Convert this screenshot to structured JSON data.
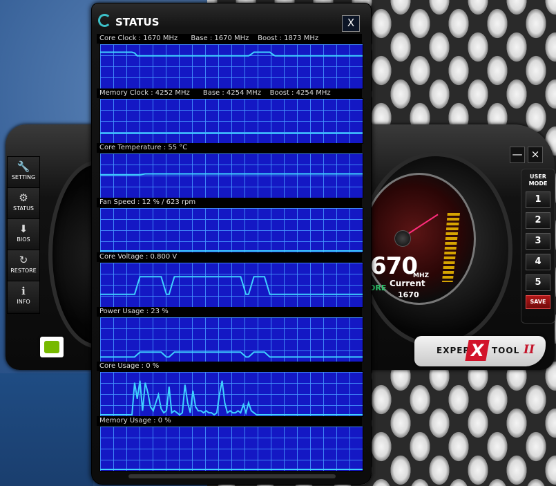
{
  "status_window": {
    "title": "STATUS",
    "close_label": "X",
    "panels": [
      {
        "label": "Core Clock : 1670 MHz      Base : 1670 MHz    Boost : 1873 MHz",
        "series": [
          0.87,
          0.87,
          0.87,
          0.87,
          0.87,
          0.87,
          0.87,
          0.87,
          0.87,
          0.87,
          0.87,
          0.87,
          0.87,
          0.85,
          0.78,
          0.78,
          0.78,
          0.78,
          0.78,
          0.78,
          0.78,
          0.78,
          0.78,
          0.78,
          0.78,
          0.78,
          0.78,
          0.78,
          0.78,
          0.78,
          0.78,
          0.78,
          0.78,
          0.78,
          0.78,
          0.78,
          0.78,
          0.78,
          0.78,
          0.78,
          0.78,
          0.78,
          0.78,
          0.78,
          0.78,
          0.78,
          0.78,
          0.78,
          0.78,
          0.78,
          0.78,
          0.78,
          0.78,
          0.78,
          0.78,
          0.78,
          0.78,
          0.82,
          0.87,
          0.87,
          0.87,
          0.87,
          0.87,
          0.87,
          0.87,
          0.82,
          0.78,
          0.78,
          0.78,
          0.78,
          0.78,
          0.78,
          0.78,
          0.78,
          0.78,
          0.78,
          0.78,
          0.78,
          0.78,
          0.78,
          0.78,
          0.78,
          0.78,
          0.78,
          0.78,
          0.78,
          0.78,
          0.78,
          0.78,
          0.78,
          0.78,
          0.78,
          0.78,
          0.78,
          0.78,
          0.78,
          0.78,
          0.78,
          0.78,
          0.78
        ]
      },
      {
        "label": "Memory Clock : 4252 MHz      Base : 4254 MHz    Boost : 4254 MHz",
        "series": [
          0.21,
          0.21,
          0.21,
          0.21,
          0.21,
          0.21,
          0.21,
          0.21,
          0.21,
          0.21,
          0.21,
          0.21,
          0.21,
          0.21,
          0.21,
          0.21,
          0.21,
          0.21,
          0.21,
          0.21,
          0.21,
          0.21,
          0.21,
          0.21,
          0.21,
          0.21,
          0.21,
          0.21,
          0.21,
          0.21,
          0.21,
          0.21,
          0.21,
          0.21,
          0.21,
          0.21,
          0.21,
          0.21,
          0.21,
          0.21,
          0.21,
          0.21,
          0.21,
          0.21,
          0.21,
          0.21,
          0.21,
          0.21,
          0.21,
          0.21,
          0.21,
          0.21,
          0.21,
          0.21,
          0.21,
          0.21,
          0.21,
          0.21,
          0.21,
          0.21,
          0.21,
          0.21,
          0.21,
          0.21,
          0.21,
          0.21,
          0.21,
          0.21,
          0.21,
          0.21,
          0.21,
          0.21,
          0.21,
          0.21,
          0.21,
          0.21,
          0.21,
          0.21,
          0.21,
          0.21,
          0.21,
          0.21,
          0.21,
          0.21,
          0.21,
          0.21,
          0.21,
          0.21,
          0.21,
          0.21,
          0.21,
          0.21,
          0.21,
          0.21,
          0.21,
          0.21,
          0.21,
          0.21,
          0.21,
          0.21
        ]
      },
      {
        "label": "Core Temperature : 55 °C",
        "series": [
          0.54,
          0.54,
          0.54,
          0.54,
          0.54,
          0.54,
          0.54,
          0.54,
          0.54,
          0.54,
          0.54,
          0.54,
          0.54,
          0.54,
          0.54,
          0.54,
          0.55,
          0.56,
          0.56,
          0.56,
          0.56,
          0.56,
          0.56,
          0.56,
          0.56,
          0.56,
          0.56,
          0.56,
          0.56,
          0.56,
          0.56,
          0.56,
          0.56,
          0.56,
          0.56,
          0.56,
          0.56,
          0.56,
          0.56,
          0.56,
          0.56,
          0.56,
          0.56,
          0.56,
          0.56,
          0.56,
          0.56,
          0.56,
          0.56,
          0.56,
          0.56,
          0.56,
          0.56,
          0.56,
          0.56,
          0.56,
          0.56,
          0.56,
          0.56,
          0.56,
          0.56,
          0.56,
          0.56,
          0.56,
          0.56,
          0.56,
          0.56,
          0.56,
          0.56,
          0.56,
          0.56,
          0.56,
          0.56,
          0.56,
          0.56,
          0.56,
          0.56,
          0.56,
          0.56,
          0.56,
          0.56,
          0.56,
          0.56,
          0.56,
          0.56,
          0.56,
          0.56,
          0.56,
          0.56,
          0.56,
          0.56,
          0.56,
          0.56,
          0.56,
          0.56,
          0.56,
          0.56,
          0.56,
          0.56,
          0.56
        ]
      },
      {
        "label": "Fan Speed : 12 % / 623 rpm",
        "series": [
          0.0,
          0.0,
          0.0,
          0.0,
          0.0,
          0.0,
          0.0,
          0.0,
          0.0,
          0.0,
          0.0,
          0.0,
          0.0,
          0.0,
          0.0,
          0.0,
          0.0,
          0.0,
          0.0,
          0.0,
          0.0,
          0.0,
          0.0,
          0.0,
          0.0,
          0.0,
          0.0,
          0.0,
          0.0,
          0.0,
          0.0,
          0.0,
          0.0,
          0.0,
          0.0,
          0.0,
          0.0,
          0.0,
          0.0,
          0.0,
          0.0,
          0.0,
          0.0,
          0.0,
          0.0,
          0.0,
          0.0,
          0.0,
          0.0,
          0.0,
          0.0,
          0.0,
          0.0,
          0.0,
          0.0,
          0.0,
          0.0,
          0.0,
          0.0,
          0.0,
          0.0,
          0.0,
          0.0,
          0.0,
          0.0,
          0.0,
          0.0,
          0.0,
          0.0,
          0.0,
          0.0,
          0.0,
          0.0,
          0.0,
          0.0,
          0.0,
          0.0,
          0.0,
          0.0,
          0.0,
          0.0,
          0.0,
          0.0,
          0.0,
          0.0,
          0.0,
          0.0,
          0.0,
          0.0,
          0.0,
          0.0,
          0.0,
          0.0,
          0.0,
          0.0,
          0.0,
          0.0,
          0.0,
          0.0,
          0.0
        ]
      },
      {
        "label": "Core Voltage : 0.800 V",
        "series": [
          0.28,
          0.28,
          0.28,
          0.28,
          0.28,
          0.28,
          0.28,
          0.28,
          0.28,
          0.28,
          0.28,
          0.28,
          0.28,
          0.28,
          0.5,
          0.72,
          0.72,
          0.72,
          0.72,
          0.72,
          0.72,
          0.72,
          0.72,
          0.72,
          0.5,
          0.28,
          0.28,
          0.5,
          0.72,
          0.72,
          0.72,
          0.72,
          0.72,
          0.72,
          0.72,
          0.72,
          0.72,
          0.72,
          0.72,
          0.72,
          0.72,
          0.72,
          0.72,
          0.72,
          0.72,
          0.72,
          0.72,
          0.72,
          0.72,
          0.72,
          0.72,
          0.72,
          0.72,
          0.72,
          0.5,
          0.28,
          0.28,
          0.5,
          0.72,
          0.72,
          0.72,
          0.72,
          0.72,
          0.5,
          0.28,
          0.28,
          0.28,
          0.28,
          0.28,
          0.28,
          0.28,
          0.28,
          0.28,
          0.28,
          0.28,
          0.28,
          0.28,
          0.28,
          0.28,
          0.28,
          0.28,
          0.28,
          0.28,
          0.28,
          0.28,
          0.28,
          0.28,
          0.28,
          0.28,
          0.28,
          0.28,
          0.28,
          0.28,
          0.28,
          0.28,
          0.28,
          0.28,
          0.28,
          0.28,
          0.28
        ]
      },
      {
        "label": "Power Usage : 23 %",
        "series": [
          0.08,
          0.08,
          0.08,
          0.08,
          0.08,
          0.08,
          0.08,
          0.08,
          0.08,
          0.08,
          0.08,
          0.08,
          0.08,
          0.08,
          0.14,
          0.2,
          0.2,
          0.2,
          0.2,
          0.2,
          0.2,
          0.2,
          0.2,
          0.2,
          0.14,
          0.08,
          0.08,
          0.14,
          0.2,
          0.2,
          0.2,
          0.2,
          0.2,
          0.2,
          0.2,
          0.2,
          0.2,
          0.2,
          0.2,
          0.2,
          0.2,
          0.2,
          0.2,
          0.2,
          0.2,
          0.2,
          0.2,
          0.2,
          0.2,
          0.2,
          0.2,
          0.2,
          0.2,
          0.2,
          0.14,
          0.08,
          0.08,
          0.14,
          0.2,
          0.2,
          0.2,
          0.2,
          0.2,
          0.14,
          0.08,
          0.08,
          0.08,
          0.08,
          0.08,
          0.08,
          0.08,
          0.08,
          0.08,
          0.08,
          0.08,
          0.08,
          0.08,
          0.08,
          0.08,
          0.08,
          0.08,
          0.08,
          0.08,
          0.08,
          0.08,
          0.08,
          0.08,
          0.08,
          0.08,
          0.08,
          0.08,
          0.08,
          0.08,
          0.08,
          0.08,
          0.08,
          0.08,
          0.08,
          0.08,
          0.08
        ]
      },
      {
        "label": "Core Usage : 0 %",
        "series": [
          0,
          0,
          0,
          0,
          0,
          0,
          0,
          0,
          0,
          0,
          0,
          0,
          0,
          0.8,
          0.4,
          0.85,
          0.1,
          0.8,
          0.55,
          0.2,
          0.1,
          0.3,
          0.5,
          0.15,
          0.05,
          0.1,
          0.7,
          0.05,
          0.1,
          0.05,
          0,
          0.05,
          0.75,
          0.3,
          0.05,
          0.6,
          0.2,
          0.1,
          0.1,
          0.05,
          0.1,
          0.05,
          0.05,
          0,
          0.05,
          0.5,
          0.85,
          0.3,
          0.05,
          0.1,
          0.05,
          0.05,
          0.1,
          0.05,
          0.25,
          0.05,
          0.3,
          0.1,
          0.05,
          0,
          0,
          0,
          0,
          0,
          0,
          0,
          0,
          0,
          0,
          0,
          0,
          0,
          0,
          0,
          0,
          0,
          0,
          0,
          0,
          0,
          0,
          0,
          0,
          0,
          0,
          0,
          0,
          0,
          0,
          0,
          0,
          0,
          0,
          0,
          0,
          0,
          0,
          0,
          0,
          0
        ]
      },
      {
        "label": "Memory Usage : 0 %",
        "series": [
          0,
          0,
          0,
          0,
          0,
          0,
          0,
          0,
          0,
          0,
          0,
          0,
          0,
          0,
          0,
          0,
          0,
          0,
          0,
          0,
          0,
          0,
          0,
          0,
          0,
          0,
          0,
          0,
          0,
          0,
          0,
          0,
          0,
          0,
          0,
          0,
          0,
          0,
          0,
          0,
          0,
          0,
          0,
          0,
          0,
          0,
          0,
          0,
          0,
          0,
          0,
          0,
          0,
          0,
          0,
          0,
          0,
          0,
          0,
          0,
          0,
          0,
          0,
          0,
          0,
          0,
          0,
          0,
          0,
          0,
          0,
          0,
          0,
          0,
          0,
          0,
          0,
          0,
          0,
          0,
          0,
          0,
          0,
          0,
          0,
          0,
          0,
          0,
          0,
          0,
          0,
          0,
          0,
          0,
          0,
          0,
          0,
          0,
          0,
          0
        ]
      }
    ],
    "colors": {
      "graph_bg": "#1418c4",
      "grid": "#4696ff",
      "line": "#3fd2ff"
    }
  },
  "left_nav": {
    "items": [
      {
        "label": "SETTING",
        "icon": "wrench-icon"
      },
      {
        "label": "STATUS",
        "icon": "gear-icon"
      },
      {
        "label": "BIOS",
        "icon": "download-arrow-icon"
      },
      {
        "label": "RESTORE",
        "icon": "refresh-icon"
      },
      {
        "label": "INFO",
        "icon": "info-icon"
      }
    ]
  },
  "main_window": {
    "minimize_label": "—",
    "close_label": "×",
    "gauge": {
      "value": "670",
      "unit": "MHZ",
      "mode_fragment": "ORE",
      "current_label": "Current",
      "current_value": "1670"
    },
    "user_mode": {
      "title_line1": "USER",
      "title_line2": "MODE",
      "buttons": [
        "1",
        "2",
        "3",
        "4",
        "5"
      ],
      "save_label": "SAVE"
    },
    "brand": {
      "left": "EXPER",
      "x": "X",
      "right": "TOOL",
      "suffix": "II"
    }
  }
}
